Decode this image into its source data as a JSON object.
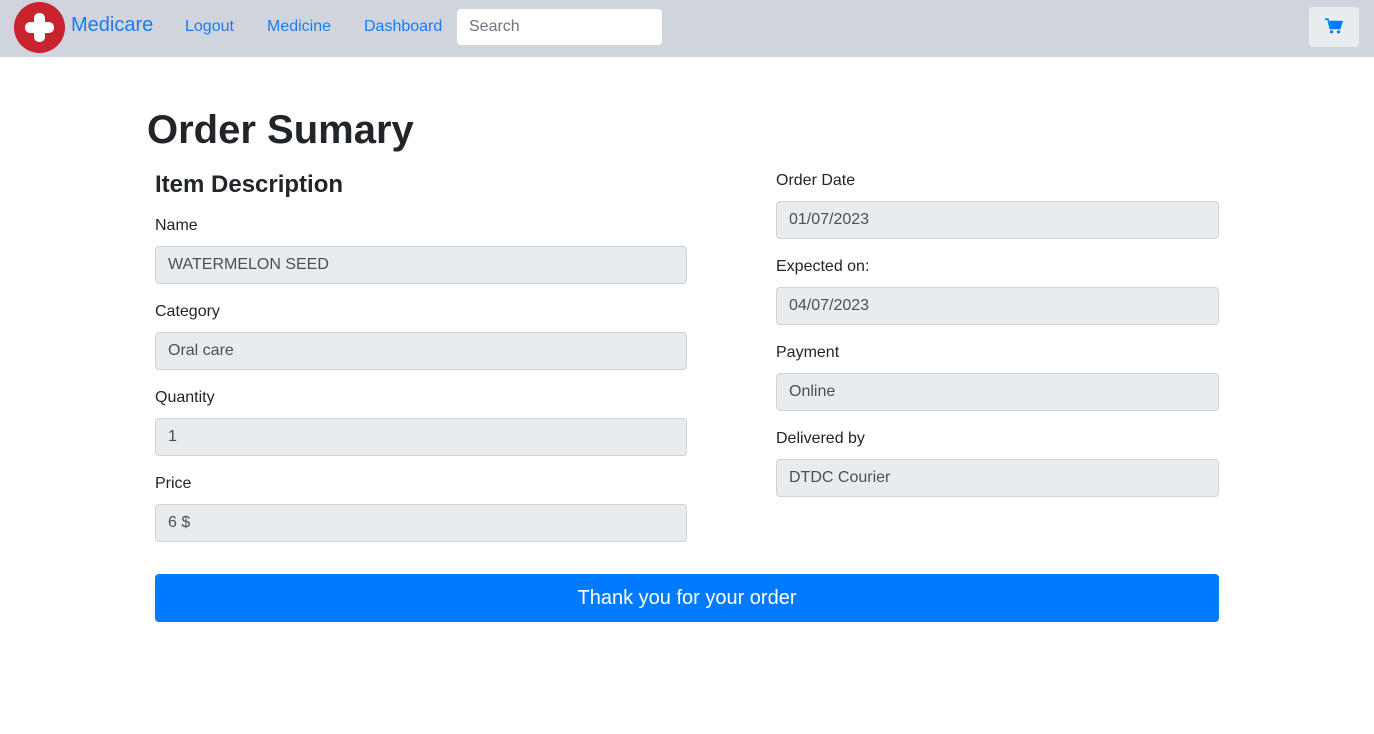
{
  "navbar": {
    "brand": "Medicare",
    "links": [
      "Logout",
      "Medicine",
      "Dashboard"
    ],
    "search_placeholder": "Search",
    "cart_icon": "shopping-cart-icon",
    "logo_icon": "medical-cross-icon",
    "background": "#d0d4dc",
    "link_color": "#1a7cf5"
  },
  "page": {
    "title": "Order Sumary",
    "item_section_title": "Item Description"
  },
  "item": {
    "name_label": "Name",
    "name_value": "WATERMELON SEED",
    "category_label": "Category",
    "category_value": "Oral care",
    "quantity_label": "Quantity",
    "quantity_value": "1",
    "price_label": "Price",
    "price_value": "6 $"
  },
  "order": {
    "date_label": "Order Date",
    "date_value": "01/07/2023",
    "expected_label": "Expected on:",
    "expected_value": "04/07/2023",
    "payment_label": "Payment",
    "payment_value": "Online",
    "delivered_label": "Delivered by",
    "delivered_value": "DTDC Courier"
  },
  "actions": {
    "thanks_label": "Thank you for your order",
    "accent": "#007bff"
  }
}
